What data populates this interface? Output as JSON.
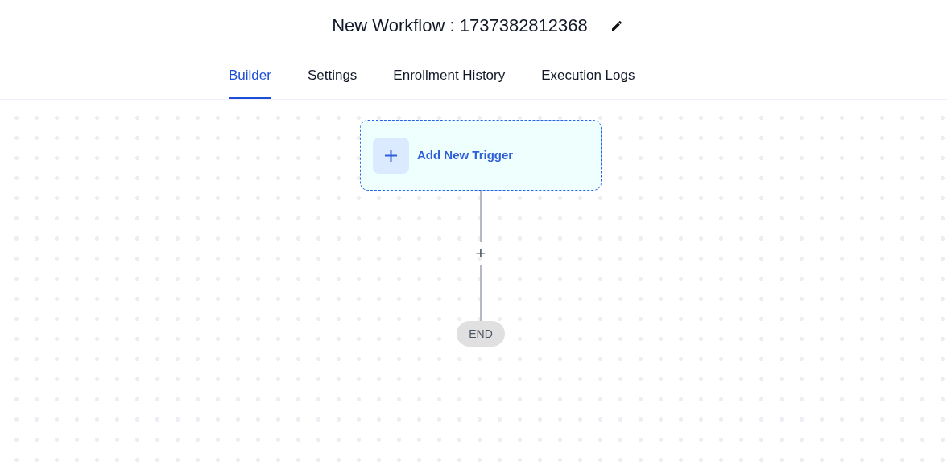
{
  "header": {
    "title": "New Workflow : 1737382812368"
  },
  "tabs": [
    {
      "label": "Builder",
      "selected": true
    },
    {
      "label": "Settings",
      "selected": false
    },
    {
      "label": "Enrollment History",
      "selected": false
    },
    {
      "label": "Execution Logs",
      "selected": false
    }
  ],
  "canvas": {
    "trigger": {
      "label": "Add New Trigger"
    },
    "add_step": {
      "label": "+"
    },
    "end": {
      "label": "END"
    }
  }
}
